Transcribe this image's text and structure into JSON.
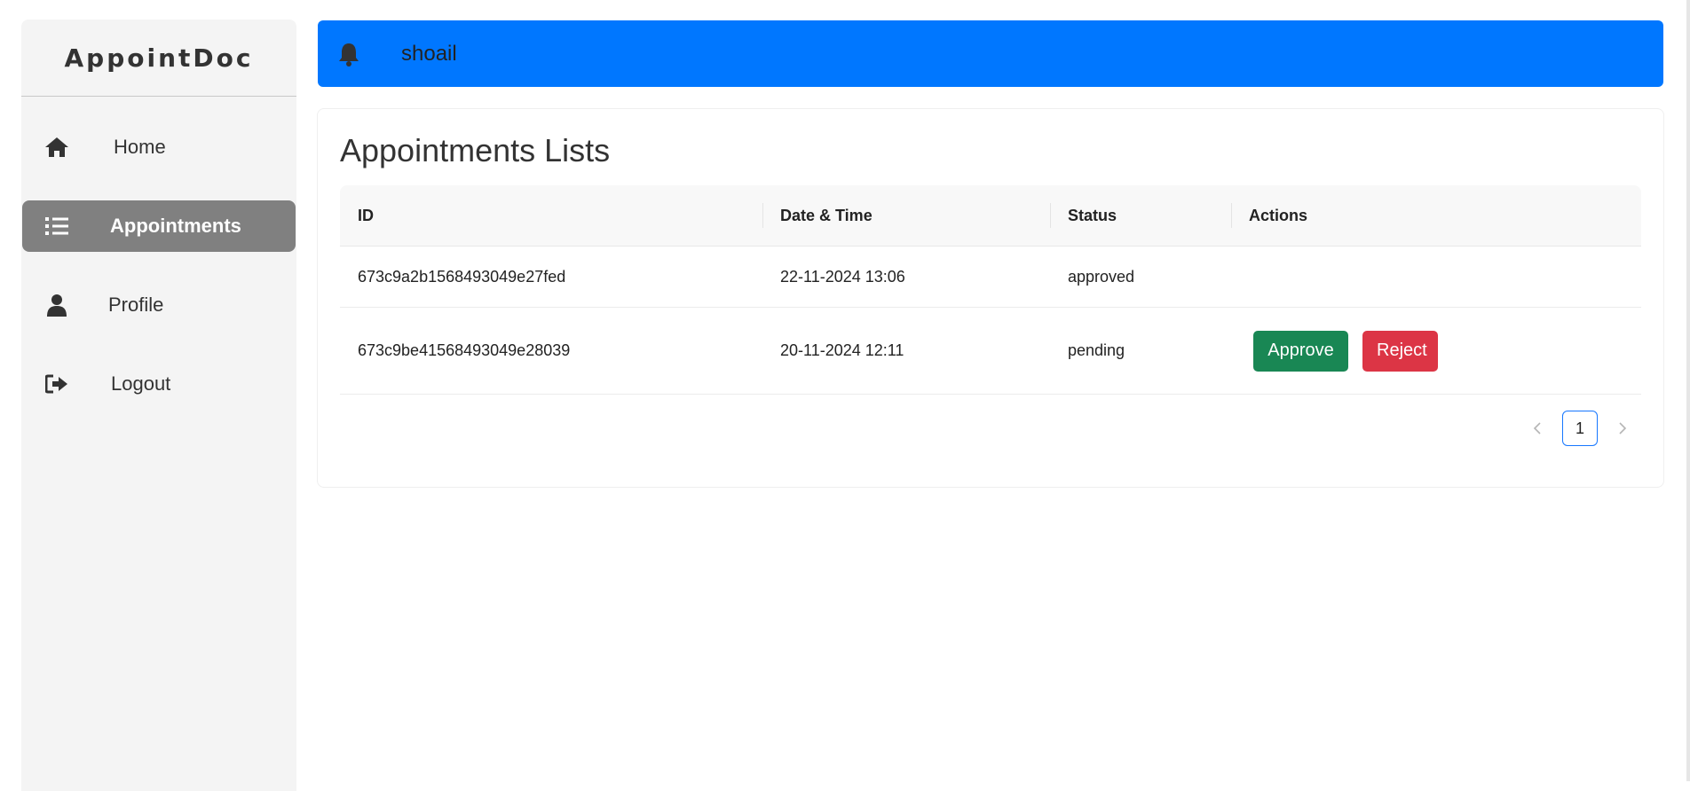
{
  "sidebar": {
    "brand": "AppointDoc",
    "items": [
      {
        "label": "Home",
        "icon": "home-icon",
        "active": false
      },
      {
        "label": "Appointments",
        "icon": "list-icon",
        "active": true
      },
      {
        "label": "Profile",
        "icon": "user-icon",
        "active": false
      },
      {
        "label": "Logout",
        "icon": "logout-icon",
        "active": false
      }
    ]
  },
  "header": {
    "username": "shoail",
    "icon": "bell-icon"
  },
  "main": {
    "title": "Appointments Lists",
    "columns": [
      "ID",
      "Date & Time",
      "Status",
      "Actions"
    ],
    "rows": [
      {
        "id": "673c9a2b1568493049e27fed",
        "datetime": "22-11-2024  13:06",
        "status": "approved"
      },
      {
        "id": "673c9be41568493049e28039",
        "datetime": "20-11-2024  12:11",
        "status": "pending",
        "approve_label": "Approve",
        "reject_label": "Reject"
      }
    ],
    "pagination": {
      "current_page": "1"
    }
  },
  "colors": {
    "header": "#0077ff",
    "sidebar_active": "#808080",
    "approve": "#198754",
    "reject": "#dc3545",
    "page_border": "#1677ff"
  }
}
